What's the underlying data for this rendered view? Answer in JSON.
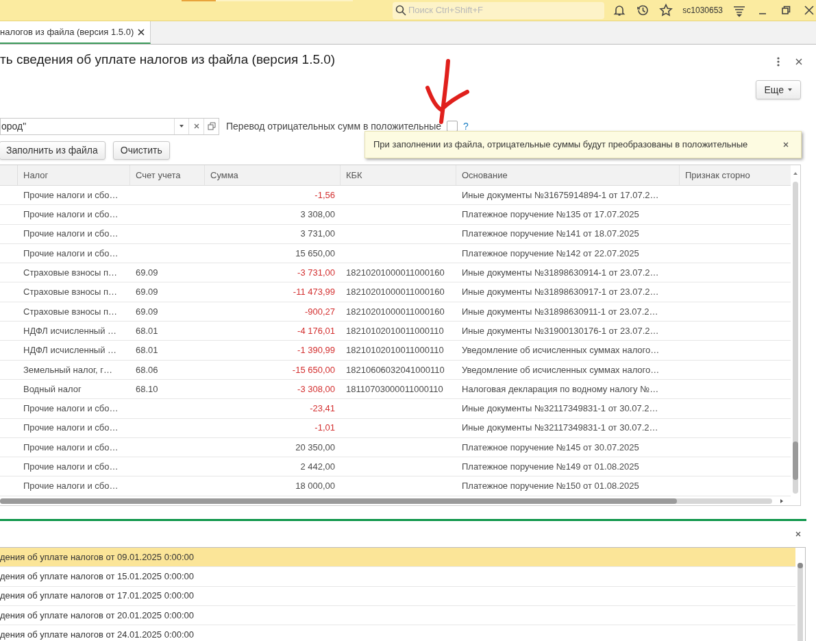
{
  "top_bar": {
    "search": {
      "placeholder": "Поиск Ctrl+Shift+F"
    },
    "user": "sc1030653"
  },
  "tabs": [
    {
      "label": "налогов из файла (версия 1.5.0)",
      "selected": true
    }
  ],
  "form": {
    "title": "ть сведения об уплате налогов из файла (версия 1.5.0)",
    "more_button": "Еще",
    "organization_field": {
      "value": "ород\""
    },
    "checkbox": {
      "label": "Перевод отрицательных сумм в положительные",
      "checked": false,
      "help": "?"
    },
    "tooltip": {
      "text": "При заполнении из файла, отрицательные суммы будут преобразованы в положительные"
    },
    "buttons": [
      "Заполнить из файла",
      "Очистить"
    ]
  },
  "table": {
    "columns": [
      "Налог",
      "Счет учета",
      "Сумма",
      "КБК",
      "Основание",
      "Признак сторно"
    ],
    "rows": [
      {
        "tax": "Прочие налоги и сбо…",
        "account": "",
        "amount": "-1,56",
        "negative": true,
        "kbk": "",
        "basis": "Иные документы №31675914894-1 от 17.07.2…"
      },
      {
        "tax": "Прочие налоги и сбо…",
        "account": "",
        "amount": "3 308,00",
        "negative": false,
        "kbk": "",
        "basis": "Платежное поручение №135 от 17.07.2025"
      },
      {
        "tax": "Прочие налоги и сбо…",
        "account": "",
        "amount": "3 731,00",
        "negative": false,
        "kbk": "",
        "basis": "Платежное поручение №141 от 18.07.2025"
      },
      {
        "tax": "Прочие налоги и сбо…",
        "account": "",
        "amount": "15 650,00",
        "negative": false,
        "kbk": "",
        "basis": "Платежное поручение №142 от 22.07.2025"
      },
      {
        "tax": "Страховые взносы п…",
        "account": "69.09",
        "amount": "-3 731,00",
        "negative": true,
        "kbk": "18210201000011000160",
        "basis": "Иные документы №31898630914-1 от 23.07.2…"
      },
      {
        "tax": "Страховые взносы п…",
        "account": "69.09",
        "amount": "-11 473,99",
        "negative": true,
        "kbk": "18210201000011000160",
        "basis": "Иные документы №31898630917-1 от 23.07.2…"
      },
      {
        "tax": "Страховые взносы п…",
        "account": "69.09",
        "amount": "-900,27",
        "negative": true,
        "kbk": "18210201000011000160",
        "basis": "Иные документы №31898630911-1 от 23.07.2…"
      },
      {
        "tax": "НДФЛ исчисленный …",
        "account": "68.01",
        "amount": "-4 176,01",
        "negative": true,
        "kbk": "18210102010011000110",
        "basis": "Иные документы №31900130176-1 от 23.07.2…"
      },
      {
        "tax": "НДФЛ исчисленный …",
        "account": "68.01",
        "amount": "-1 390,99",
        "negative": true,
        "kbk": "18210102010011000110",
        "basis": "Уведомление об исчисленных суммах налого…"
      },
      {
        "tax": "Земельный налог, г…",
        "account": "68.06",
        "amount": "-15 650,00",
        "negative": true,
        "kbk": "18210606032041000110",
        "basis": "Уведомление об исчисленных суммах налого…"
      },
      {
        "tax": "Водный налог",
        "account": "68.10",
        "amount": "-3 308,00",
        "negative": true,
        "kbk": "18110703000011000110",
        "basis": "Налоговая декларация по водному налогу №…"
      },
      {
        "tax": "Прочие налоги и сбо…",
        "account": "",
        "amount": "-23,41",
        "negative": true,
        "kbk": "",
        "basis": "Иные документы №32117349831-1 от 30.07.2…"
      },
      {
        "tax": "Прочие налоги и сбо…",
        "account": "",
        "amount": "-1,01",
        "negative": true,
        "kbk": "",
        "basis": "Иные документы №32117349831-1 от 30.07.2…"
      },
      {
        "tax": "Прочие налоги и сбо…",
        "account": "",
        "amount": "20 350,00",
        "negative": false,
        "kbk": "",
        "basis": "Платежное поручение №145 от 30.07.2025"
      },
      {
        "tax": "Прочие налоги и сбо…",
        "account": "",
        "amount": "2 442,00",
        "negative": false,
        "kbk": "",
        "basis": "Платежное поручение №149 от 01.08.2025"
      },
      {
        "tax": "Прочие налоги и сбо…",
        "account": "",
        "amount": "18 000,00",
        "negative": false,
        "kbk": "",
        "basis": "Платежное поручение №150 от 01.08.2025"
      }
    ]
  },
  "history_list": {
    "items": [
      {
        "label": "дения об уплате налогов от 09.01.2025 0:00:00",
        "selected": true
      },
      {
        "label": "дения об уплате налогов от 15.01.2025 0:00:00",
        "selected": false
      },
      {
        "label": "дения об уплате налогов от 17.01.2025 0:00:00",
        "selected": false
      },
      {
        "label": "дения об уплате налогов от 20.01.2025 0:00:00",
        "selected": false
      },
      {
        "label": "дения об уплате налогов от 24.01.2025 0:00:00",
        "selected": false
      }
    ]
  }
}
